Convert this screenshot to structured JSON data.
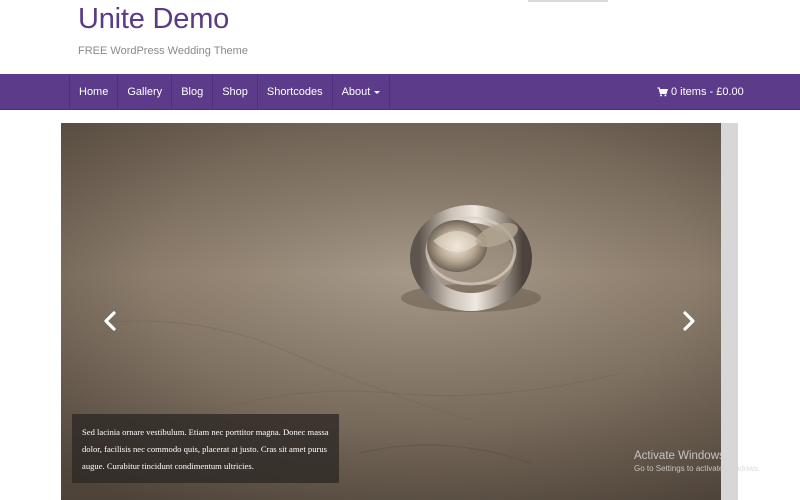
{
  "site": {
    "title": "Unite Demo",
    "tagline": "FREE WordPress Wedding Theme"
  },
  "nav": {
    "items": [
      {
        "label": "Home"
      },
      {
        "label": "Gallery"
      },
      {
        "label": "Blog"
      },
      {
        "label": "Shop"
      },
      {
        "label": "Shortcodes"
      },
      {
        "label": "About"
      }
    ],
    "cart_label": "0 items - £0.00"
  },
  "slider": {
    "caption": "Sed lacinia ornare vestibulum. Etiam nec porttitor magna. Donec massa dolor, facilisis nec commodo quis, placerat at justo. Cras sit amet purus augue. Curabitur tincidunt condimentum ultricies."
  },
  "watermark": {
    "title": "Activate Windows",
    "subtitle": "Go to Settings to activate Windows."
  },
  "colors": {
    "brand": "#5b3a86",
    "nav_bg": "#5c3b8a"
  }
}
